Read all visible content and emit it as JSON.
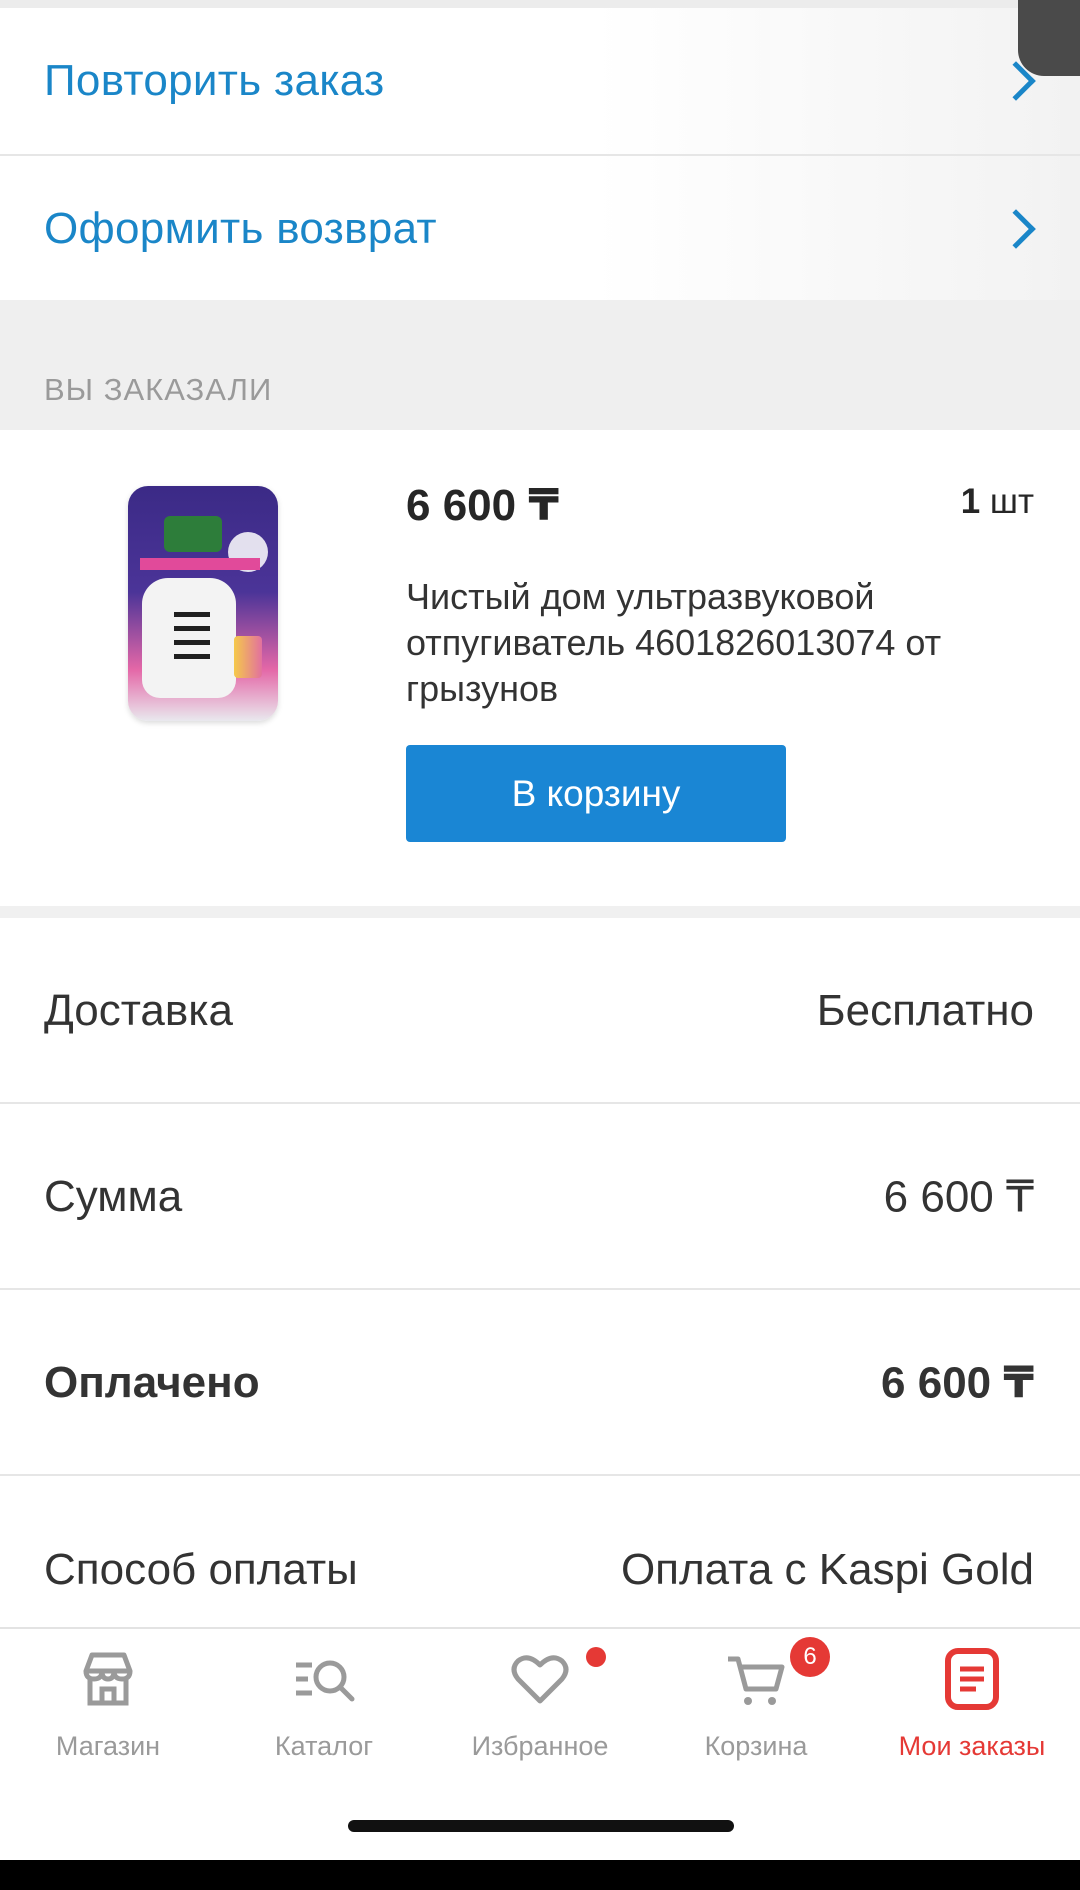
{
  "actions": [
    {
      "label": "Повторить заказ"
    },
    {
      "label": "Оформить возврат"
    }
  ],
  "section": {
    "title": "ВЫ ЗАКАЗАЛИ"
  },
  "product": {
    "price": "6 600 ₸",
    "quantity_value": "1",
    "quantity_unit": "шт",
    "name": "Чистый дом ультразвуковой отпугиватель 4601826013074 от грызунов",
    "cart_button": "В корзину",
    "image_icon": "product-package-icon"
  },
  "summary": [
    {
      "label": "Доставка",
      "value": "Бесплатно"
    },
    {
      "label": "Сумма",
      "value": "6 600 ₸"
    },
    {
      "label": "Оплачено",
      "value": "6 600 ₸"
    },
    {
      "label": "Способ оплаты",
      "value": "Оплата с Kaspi Gold"
    }
  ],
  "tabbar": {
    "items": [
      {
        "label": "Магазин",
        "icon": "store-icon"
      },
      {
        "label": "Каталог",
        "icon": "catalog-search-icon"
      },
      {
        "label": "Избранное",
        "icon": "heart-icon"
      },
      {
        "label": "Корзина",
        "icon": "cart-icon"
      },
      {
        "label": "Мои заказы",
        "icon": "orders-icon"
      }
    ],
    "cart_badge": "6",
    "active_index": 4
  },
  "colors": {
    "accent_blue": "#1a86c8",
    "button_blue": "#1a86d4",
    "active_red": "#e53935",
    "muted_gray": "#9a9a9a"
  }
}
